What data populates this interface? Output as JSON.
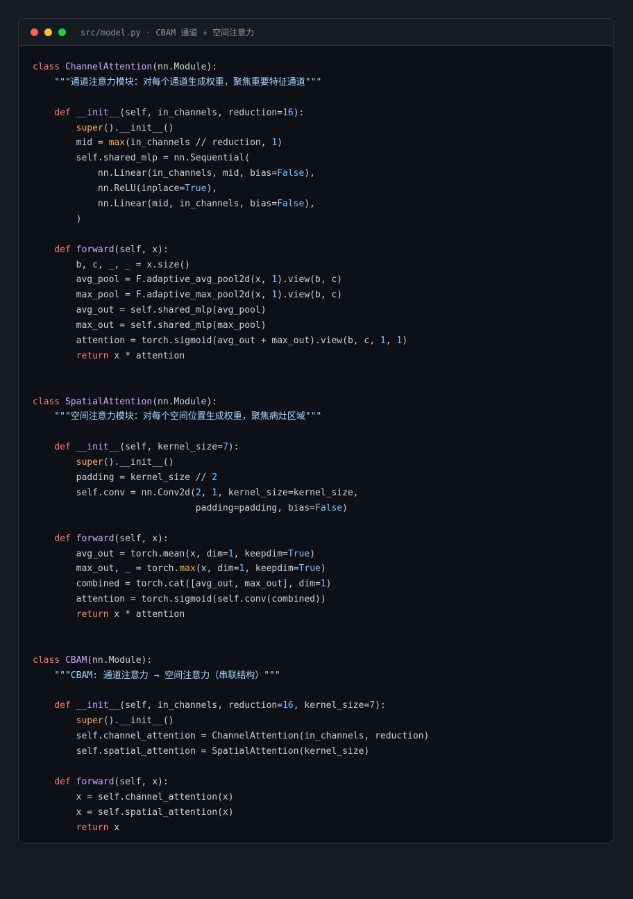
{
  "window": {
    "title": "src/model.py · CBAM 通道 + 空间注意力"
  },
  "code": {
    "lines": [
      [
        [
          "k",
          "class "
        ],
        [
          "c",
          "ChannelAttention"
        ],
        [
          "p",
          "(nn.Module):"
        ]
      ],
      [
        [
          "s",
          "    \"\"\"通道注意力模块：对每个通道生成权重，聚焦重要特征通道\"\"\""
        ]
      ],
      [],
      [
        [
          "p",
          "    "
        ],
        [
          "k",
          "def "
        ],
        [
          "f",
          "__init__"
        ],
        [
          "p",
          "(self, in_channels, reduction="
        ],
        [
          "n",
          "16"
        ],
        [
          "p",
          "):"
        ]
      ],
      [
        [
          "p",
          "        "
        ],
        [
          "b",
          "super"
        ],
        [
          "p",
          "().__init__()"
        ]
      ],
      [
        [
          "p",
          "        mid = "
        ],
        [
          "b",
          "max"
        ],
        [
          "p",
          "(in_channels // reduction, "
        ],
        [
          "n",
          "1"
        ],
        [
          "p",
          ")"
        ]
      ],
      [
        [
          "p",
          "        self.shared_mlp = nn.Sequential("
        ]
      ],
      [
        [
          "p",
          "            nn.Linear(in_channels, mid, bias="
        ],
        [
          "n",
          "False"
        ],
        [
          "p",
          "),"
        ]
      ],
      [
        [
          "p",
          "            nn.ReLU(inplace="
        ],
        [
          "n",
          "True"
        ],
        [
          "p",
          "),"
        ]
      ],
      [
        [
          "p",
          "            nn.Linear(mid, in_channels, bias="
        ],
        [
          "n",
          "False"
        ],
        [
          "p",
          "),"
        ]
      ],
      [
        [
          "p",
          "        )"
        ]
      ],
      [],
      [
        [
          "p",
          "    "
        ],
        [
          "k",
          "def "
        ],
        [
          "f",
          "forward"
        ],
        [
          "p",
          "(self, x):"
        ]
      ],
      [
        [
          "p",
          "        b, c, _, _ = x.size()"
        ]
      ],
      [
        [
          "p",
          "        avg_pool = F.adaptive_avg_pool2d(x, "
        ],
        [
          "n",
          "1"
        ],
        [
          "p",
          ").view(b, c)"
        ]
      ],
      [
        [
          "p",
          "        max_pool = F.adaptive_max_pool2d(x, "
        ],
        [
          "n",
          "1"
        ],
        [
          "p",
          ").view(b, c)"
        ]
      ],
      [
        [
          "p",
          "        avg_out = self.shared_mlp(avg_pool)"
        ]
      ],
      [
        [
          "p",
          "        max_out = self.shared_mlp(max_pool)"
        ]
      ],
      [
        [
          "p",
          "        attention = torch.sigmoid(avg_out + max_out).view(b, c, "
        ],
        [
          "n",
          "1"
        ],
        [
          "p",
          ", "
        ],
        [
          "n",
          "1"
        ],
        [
          "p",
          ")"
        ]
      ],
      [
        [
          "p",
          "        "
        ],
        [
          "k",
          "return"
        ],
        [
          "p",
          " x * attention"
        ]
      ],
      [],
      [],
      [
        [
          "k",
          "class "
        ],
        [
          "c",
          "SpatialAttention"
        ],
        [
          "p",
          "(nn.Module):"
        ]
      ],
      [
        [
          "s",
          "    \"\"\"空间注意力模块：对每个空间位置生成权重，聚焦病灶区域\"\"\""
        ]
      ],
      [],
      [
        [
          "p",
          "    "
        ],
        [
          "k",
          "def "
        ],
        [
          "f",
          "__init__"
        ],
        [
          "p",
          "(self, kernel_size="
        ],
        [
          "n",
          "7"
        ],
        [
          "p",
          "):"
        ]
      ],
      [
        [
          "p",
          "        "
        ],
        [
          "b",
          "super"
        ],
        [
          "p",
          "().__init__()"
        ]
      ],
      [
        [
          "p",
          "        padding = kernel_size // "
        ],
        [
          "n",
          "2"
        ]
      ],
      [
        [
          "p",
          "        self.conv = nn.Conv2d("
        ],
        [
          "n",
          "2"
        ],
        [
          "p",
          ", "
        ],
        [
          "n",
          "1"
        ],
        [
          "p",
          ", kernel_size=kernel_size,"
        ]
      ],
      [
        [
          "p",
          "                              padding=padding, bias="
        ],
        [
          "n",
          "False"
        ],
        [
          "p",
          ")"
        ]
      ],
      [],
      [
        [
          "p",
          "    "
        ],
        [
          "k",
          "def "
        ],
        [
          "f",
          "forward"
        ],
        [
          "p",
          "(self, x):"
        ]
      ],
      [
        [
          "p",
          "        avg_out = torch.mean(x, dim="
        ],
        [
          "n",
          "1"
        ],
        [
          "p",
          ", keepdim="
        ],
        [
          "n",
          "True"
        ],
        [
          "p",
          ")"
        ]
      ],
      [
        [
          "p",
          "        max_out, _ = torch."
        ],
        [
          "b",
          "max"
        ],
        [
          "p",
          "(x, dim="
        ],
        [
          "n",
          "1"
        ],
        [
          "p",
          ", keepdim="
        ],
        [
          "n",
          "True"
        ],
        [
          "p",
          ")"
        ]
      ],
      [
        [
          "p",
          "        combined = torch.cat([avg_out, max_out], dim="
        ],
        [
          "n",
          "1"
        ],
        [
          "p",
          ")"
        ]
      ],
      [
        [
          "p",
          "        attention = torch.sigmoid(self.conv(combined))"
        ]
      ],
      [
        [
          "p",
          "        "
        ],
        [
          "k",
          "return"
        ],
        [
          "p",
          " x * attention"
        ]
      ],
      [],
      [],
      [
        [
          "k",
          "class "
        ],
        [
          "c",
          "CBAM"
        ],
        [
          "p",
          "(nn.Module):"
        ]
      ],
      [
        [
          "s",
          "    \"\"\"CBAM: 通道注意力 → 空间注意力（串联结构）\"\"\""
        ]
      ],
      [],
      [
        [
          "p",
          "    "
        ],
        [
          "k",
          "def "
        ],
        [
          "f",
          "__init__"
        ],
        [
          "p",
          "(self, in_channels, reduction="
        ],
        [
          "n",
          "16"
        ],
        [
          "p",
          ", kernel_size="
        ],
        [
          "n",
          "7"
        ],
        [
          "p",
          "):"
        ]
      ],
      [
        [
          "p",
          "        "
        ],
        [
          "b",
          "super"
        ],
        [
          "p",
          "().__init__()"
        ]
      ],
      [
        [
          "p",
          "        self.channel_attention = ChannelAttention(in_channels, reduction)"
        ]
      ],
      [
        [
          "p",
          "        self.spatial_attention = SpatialAttention(kernel_size)"
        ]
      ],
      [],
      [
        [
          "p",
          "    "
        ],
        [
          "k",
          "def "
        ],
        [
          "f",
          "forward"
        ],
        [
          "p",
          "(self, x):"
        ]
      ],
      [
        [
          "p",
          "        x = self.channel_attention(x)"
        ]
      ],
      [
        [
          "p",
          "        x = self.spatial_attention(x)"
        ]
      ],
      [
        [
          "p",
          "        "
        ],
        [
          "k",
          "return"
        ],
        [
          "p",
          " x"
        ]
      ]
    ]
  }
}
